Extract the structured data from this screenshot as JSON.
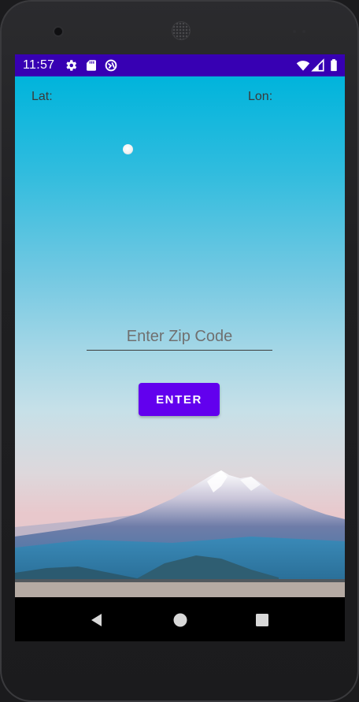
{
  "status_bar": {
    "time": "11:57",
    "background_color": "#3700b3",
    "left_icons": [
      "gear-icon",
      "sd-card-icon",
      "sync-circle-icon"
    ],
    "right_icons": [
      "wifi-icon",
      "signal-icon",
      "battery-icon"
    ]
  },
  "app": {
    "lat_label": "Lat:",
    "lon_label": "Lon:",
    "zip_input": {
      "placeholder": "Enter Zip Code",
      "value": ""
    },
    "enter_button_label": "ENTER",
    "accent_color": "#6200ee",
    "background_image": "mountain-sky-landscape"
  },
  "navigation_bar": {
    "buttons": [
      "back-icon",
      "home-icon",
      "recents-icon"
    ]
  }
}
